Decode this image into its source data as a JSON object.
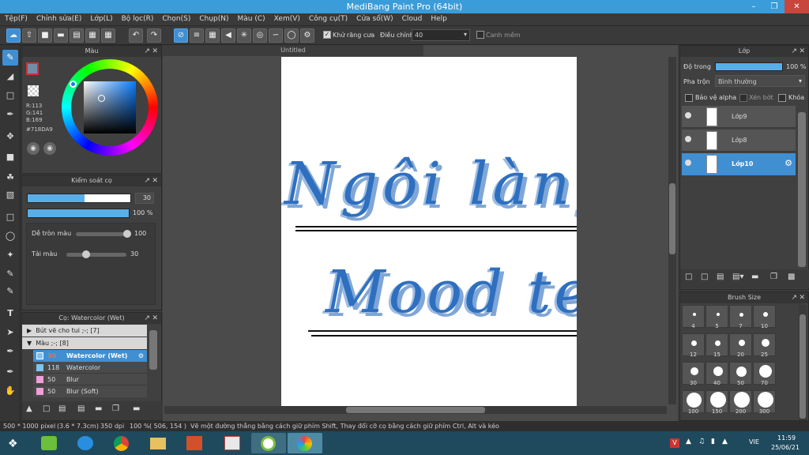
{
  "window": {
    "title": "MediBang Paint Pro (64bit)"
  },
  "menu": [
    "Tệp(F)",
    "Chỉnh sửa(E)",
    "Lớp(L)",
    "Bộ lọc(R)",
    "Chọn(S)",
    "Chụp(N)",
    "Màu (C)",
    "Xem(V)",
    "Công cụ(T)",
    "Cửa sổ(W)",
    "Cloud",
    "Help"
  ],
  "toolbar": {
    "antialias_label": "Khử răng cưa",
    "adjust_label": "Điều chỉnh",
    "adjust_value": "40",
    "edge_label": "Canh mềm"
  },
  "color_panel": {
    "title": "Màu",
    "r": "R:113",
    "g": "G:141",
    "b": "B:169",
    "hex": "#718DA9",
    "primary_color": "#718DA9"
  },
  "brush_control": {
    "title": "Kiểm soát cọ",
    "size_value": "30",
    "opacity_value": "100 %",
    "smooth_label": "Dễ tròn màu",
    "smooth_value": "100",
    "wet_label": "Tải màu",
    "wet_value": "30"
  },
  "brush_list": {
    "title": "Cọ: Watercolor (Wet)",
    "groups": [
      {
        "label": "Bút vẽ cho tui ;-; [7]",
        "expanded": false
      },
      {
        "label": "Màu ;-; [8]",
        "expanded": true
      }
    ],
    "items": [
      {
        "size": "30",
        "name": "Watercolor (Wet)",
        "color": "#7fc3ef",
        "selected": true
      },
      {
        "size": "118",
        "name": "Watercolor",
        "color": "#7fc3ef",
        "selected": false
      },
      {
        "size": "50",
        "name": "Blur",
        "color": "#f0a0d8",
        "selected": false
      },
      {
        "size": "50",
        "name": "Blur (Soft)",
        "color": "#f0a0d8",
        "selected": false
      }
    ]
  },
  "canvas": {
    "tab_title": "Untitled",
    "text_line1": "Ngôi làng",
    "text_line2": "Mood team"
  },
  "layer_panel": {
    "title": "Lớp",
    "opacity_label": "Độ trong",
    "opacity_value": "100 %",
    "blend_label": "Pha trộn",
    "blend_value": "Bình thường",
    "protect_alpha": "Bảo vệ alpha",
    "clip": "Xén bớt",
    "lock": "Khóa",
    "layers": [
      {
        "name": "Lớp9",
        "selected": false
      },
      {
        "name": "Lớp8",
        "selected": false
      },
      {
        "name": "Lớp10",
        "selected": true
      }
    ]
  },
  "brush_size_panel": {
    "title": "Brush Size",
    "sizes": [
      "4",
      "5",
      "7",
      "10",
      "12",
      "15",
      "20",
      "25",
      "30",
      "40",
      "50",
      "70",
      "100",
      "150",
      "200",
      "300"
    ]
  },
  "status": {
    "dims": "500 * 1000 pixel",
    "cm": "(3.6 * 7.3cm)",
    "dpi": "350 dpi",
    "zoom": "100 %",
    "coords": "( 506, 154 )",
    "hint": "Vẽ một đường thẳng bằng cách giữ phím Shift, Thay đổi cỡ cọ bằng cách giữ phím Ctrl, Alt và kéo"
  },
  "taskbar": {
    "lang": "VIE",
    "time": "11:59",
    "date": "25/06/21"
  }
}
